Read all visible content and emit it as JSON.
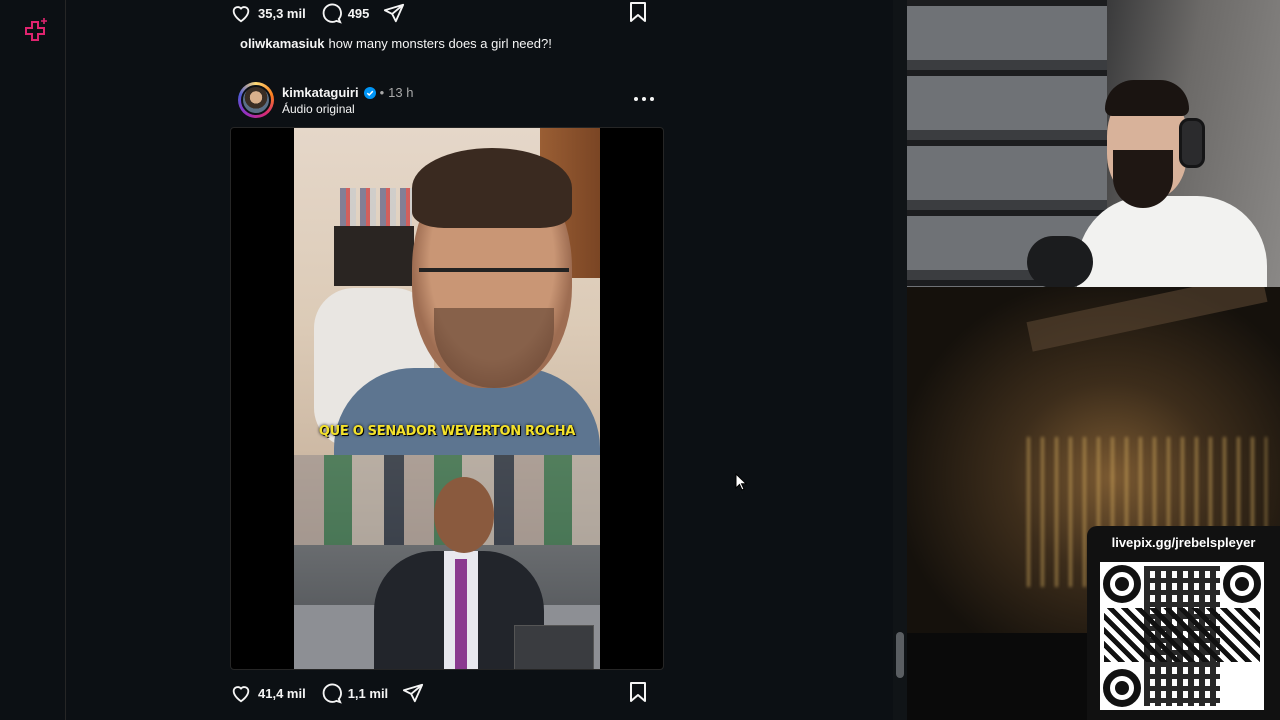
{
  "prev_post": {
    "likes": "35,3 mil",
    "comments": "495",
    "caption_user": "oliwkamasiuk",
    "caption_text": "how many monsters does a girl need?!"
  },
  "post": {
    "username": "kimkataguiri",
    "separator": "•",
    "time": "13 h",
    "audio": "Áudio original",
    "video_subtitle": "QUE O SENADOR WEVERTON ROCHA",
    "likes": "41,4 mil",
    "comments": "1,1 mil"
  },
  "overlay": {
    "livepix_label": "livepix.gg/jrebelspleyer"
  },
  "colors": {
    "background": "#0c1014",
    "rail_icon": "#e0246f",
    "verified": "#0095f6",
    "subtitle": "#f4e22a"
  },
  "icons": {
    "like": "heart-icon",
    "comment": "comment-bubble-icon",
    "share": "paper-plane-icon",
    "save": "bookmark-icon",
    "more": "more-dots-icon",
    "rail": "sparkle-cross-icon"
  }
}
